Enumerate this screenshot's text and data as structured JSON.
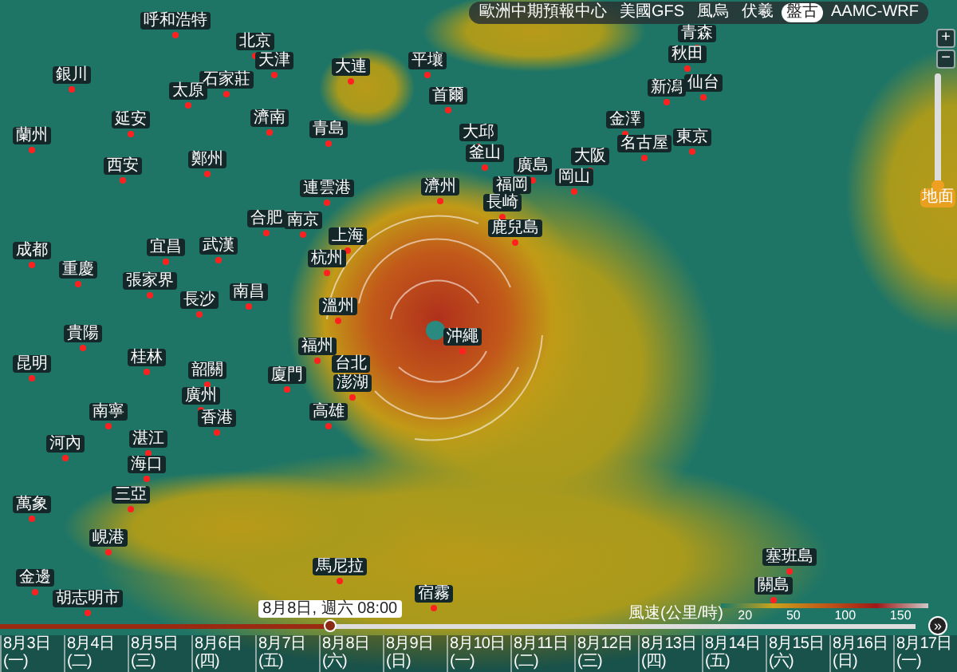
{
  "model_tabs": [
    {
      "label": "歐洲中期預報中心",
      "selected": false
    },
    {
      "label": "美國GFS",
      "selected": false
    },
    {
      "label": "風烏",
      "selected": false
    },
    {
      "label": "伏羲",
      "selected": false
    },
    {
      "label": "盤古",
      "selected": true
    },
    {
      "label": "AAMC-WRF",
      "selected": false
    }
  ],
  "zoom_controls": {
    "zoom_in": "+",
    "zoom_out": "−"
  },
  "altitude_slider": {
    "level": 0,
    "label": "地面"
  },
  "cities": [
    "呼和浩特",
    "北京",
    "天津",
    "大連",
    "平壤",
    "銀川",
    "石家莊",
    "太原",
    "首爾",
    "延安",
    "濟南",
    "青島",
    "蘭州",
    "鄭州",
    "西安",
    "連雲港",
    "濟州",
    "大邱",
    "釜山",
    "青森",
    "秋田",
    "新潟",
    "仙台",
    "金澤",
    "東京",
    "名古屋",
    "大阪",
    "廣島",
    "岡山",
    "福岡",
    "長崎",
    "鹿兒島",
    "合肥",
    "南京",
    "上海",
    "成都",
    "宜昌",
    "武漢",
    "杭州",
    "重慶",
    "張家界",
    "長沙",
    "南昌",
    "溫州",
    "貴陽",
    "沖繩",
    "福州",
    "台北",
    "澎湖",
    "高雄",
    "廈門",
    "韶關",
    "桂林",
    "昆明",
    "廣州",
    "南寧",
    "香港",
    "湛江",
    "河內",
    "海口",
    "三亞",
    "萬象",
    "峴港",
    "馬尼拉",
    "塞班島",
    "關島",
    "金邊",
    "胡志明市",
    "宿霧"
  ],
  "legend": {
    "title": "風速(公里/時)",
    "ticks": [
      "20",
      "50",
      "100",
      "150"
    ]
  },
  "timeline": {
    "level": 0.36,
    "tooltip": "8月8日, 週六 08:00",
    "forward": "»",
    "days": [
      {
        "date": "8月3日",
        "weekday": "(一)"
      },
      {
        "date": "8月4日",
        "weekday": "(二)"
      },
      {
        "date": "8月5日",
        "weekday": "(三)"
      },
      {
        "date": "8月6日",
        "weekday": "(四)"
      },
      {
        "date": "8月7日",
        "weekday": "(五)"
      },
      {
        "date": "8月8日",
        "weekday": "(六)"
      },
      {
        "date": "8月9日",
        "weekday": "(日)"
      },
      {
        "date": "8月10日",
        "weekday": "(一)"
      },
      {
        "date": "8月11日",
        "weekday": "(二)"
      },
      {
        "date": "8月12日",
        "weekday": "(三)"
      },
      {
        "date": "8月13日",
        "weekday": "(四)"
      },
      {
        "date": "8月14日",
        "weekday": "(五)"
      },
      {
        "date": "8月15日",
        "weekday": "(六)"
      },
      {
        "date": "8月16日",
        "weekday": "(日)"
      },
      {
        "date": "8月17日",
        "weekday": "(一)"
      }
    ]
  }
}
